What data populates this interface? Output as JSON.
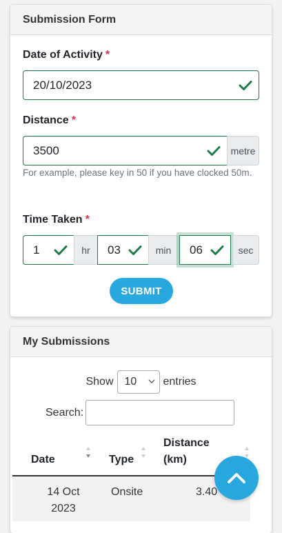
{
  "form": {
    "title": "Submission Form",
    "date": {
      "label": "Date of Activity",
      "required": "*",
      "value": "20/10/2023"
    },
    "distance": {
      "label": "Distance",
      "required": "*",
      "value": "3500",
      "unit": "metre",
      "help": "For example, please key in 50 if you have clocked 50m."
    },
    "time": {
      "label": "Time Taken",
      "required": "*",
      "hours": "1",
      "hours_unit": "hr",
      "minutes": "03",
      "minutes_unit": "min",
      "seconds": "06",
      "seconds_unit": "sec"
    },
    "submit_label": "SUBMIT"
  },
  "submissions": {
    "title": "My Submissions",
    "show_label": "Show",
    "entries_value": "10",
    "entries_label": "entries",
    "search_label": "Search:",
    "columns": [
      "Date",
      "Type",
      "Distance (km)"
    ],
    "rows": [
      {
        "date": "14 Oct 2023",
        "type": "Onsite",
        "distance": "3.40"
      }
    ]
  },
  "colors": {
    "valid": "#1f7a4a",
    "accent": "#29a8e0",
    "required": "#dc3545"
  },
  "icons": {
    "valid": "check-icon",
    "scroll_top": "chevron-up-icon",
    "sort": "sort-icon",
    "select": "chevron-down-icon"
  }
}
